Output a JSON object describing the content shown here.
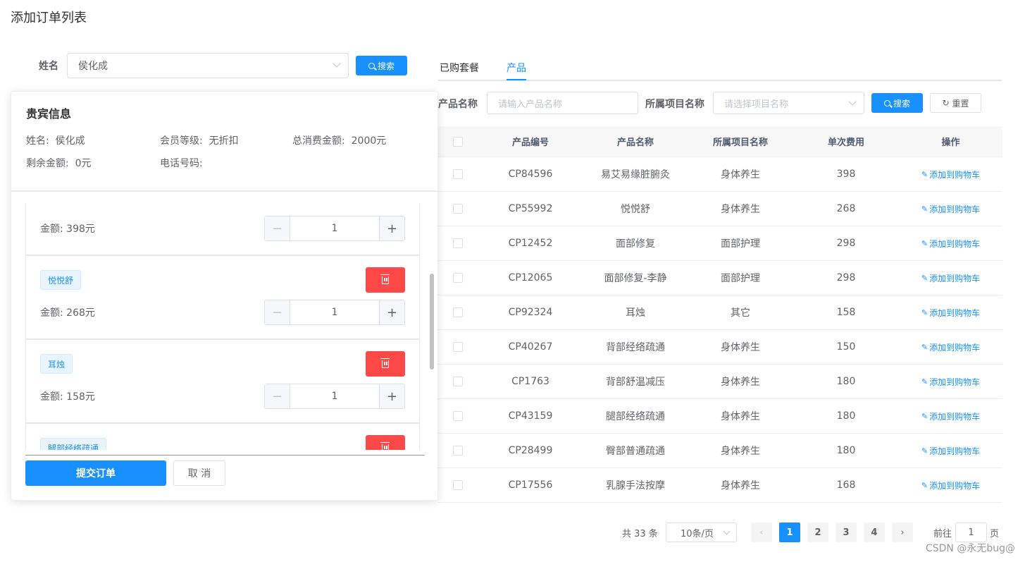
{
  "page_title": "添加订单列表",
  "left_search": {
    "label": "姓名",
    "value": "侯化成",
    "search_label": "搜索"
  },
  "guest": {
    "title": "贵宾信息",
    "name_key": "姓名:",
    "name_val": "侯化成",
    "level_key": "会员等级:",
    "level_val": "无折扣",
    "total_key": "总消费金额:",
    "total_val": "2000元",
    "balance_key": "剩余金额:",
    "balance_val": "0元",
    "phone_key": "电话号码:",
    "phone_val": ""
  },
  "cart": [
    {
      "tag": "",
      "amount": "金额: 398元",
      "qty": "1"
    },
    {
      "tag": "悦悦舒",
      "amount": "金额: 268元",
      "qty": "1"
    },
    {
      "tag": "耳烛",
      "amount": "金额: 158元",
      "qty": "1"
    },
    {
      "tag": "腿部经络疏通",
      "amount": "",
      "qty": ""
    }
  ],
  "actions": {
    "submit": "提交订单",
    "cancel": "取 消"
  },
  "tabs": [
    "已购套餐",
    "产品"
  ],
  "active_tab": "产品",
  "filters": {
    "product_name_label": "产品名称",
    "product_name_placeholder": "请输入产品名称",
    "project_label": "所属项目名称",
    "project_placeholder": "请选择项目名称",
    "search": "搜索",
    "reset": "重置"
  },
  "table": {
    "headers": [
      "产品编号",
      "产品名称",
      "所属项目名称",
      "单次费用",
      "操作"
    ],
    "op_label": "添加到购物车",
    "rows": [
      {
        "code": "CP84596",
        "name": "易艾易缘脏腑灸",
        "project": "身体养生",
        "fee": "398"
      },
      {
        "code": "CP55992",
        "name": "悦悦舒",
        "project": "身体养生",
        "fee": "268"
      },
      {
        "code": "CP12452",
        "name": "面部修复",
        "project": "面部护理",
        "fee": "298"
      },
      {
        "code": "CP12065",
        "name": "面部修复-李静",
        "project": "面部护理",
        "fee": "298"
      },
      {
        "code": "CP92324",
        "name": "耳烛",
        "project": "其它",
        "fee": "158"
      },
      {
        "code": "CP40267",
        "name": "背部经络疏通",
        "project": "身体养生",
        "fee": "150"
      },
      {
        "code": "CP1763",
        "name": "背部舒温减压",
        "project": "身体养生",
        "fee": "180"
      },
      {
        "code": "CP43159",
        "name": "腿部经络疏通",
        "project": "身体养生",
        "fee": "180"
      },
      {
        "code": "CP28499",
        "name": "臀部普通疏通",
        "project": "身体养生",
        "fee": "180"
      },
      {
        "code": "CP17556",
        "name": "乳腺手法按摩",
        "project": "身体养生",
        "fee": "168"
      }
    ]
  },
  "pagination": {
    "total": "共 33 条",
    "page_size": "10条/页",
    "pages": [
      "1",
      "2",
      "3",
      "4"
    ],
    "current": "1",
    "goto_label": "前往",
    "goto_value": "1",
    "page_label": "页"
  },
  "watermark": "CSDN @永无bug@"
}
